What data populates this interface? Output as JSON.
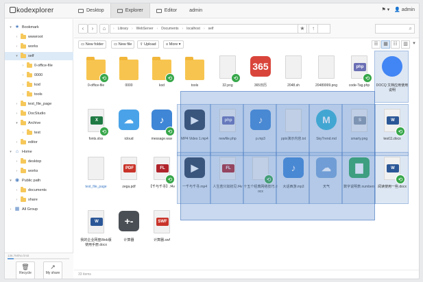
{
  "app": {
    "logo": "kodexplorer",
    "user": "admin"
  },
  "menu": [
    {
      "label": "Desktop",
      "icon": "desktop-icon",
      "active": false
    },
    {
      "label": "Explorer",
      "icon": "explorer-icon",
      "active": true
    },
    {
      "label": "Editor",
      "icon": "editor-icon",
      "active": false
    },
    {
      "label": "admin",
      "icon": "",
      "active": false
    }
  ],
  "sidebar": {
    "nodes": [
      {
        "label": "Bookmark",
        "icon": "star-icon",
        "expanded": true,
        "selected": false
      },
      {
        "label": "wwwroot",
        "icon": "folder-icon",
        "expanded": false,
        "selected": false
      },
      {
        "label": "works",
        "icon": "folder-icon",
        "expanded": false,
        "selected": false
      },
      {
        "label": "self",
        "icon": "folder-icon",
        "expanded": true,
        "selected": true
      },
      {
        "label": "0-office-file",
        "icon": "folder-icon",
        "expanded": false,
        "selected": false
      },
      {
        "label": "0000",
        "icon": "folder-icon",
        "expanded": false,
        "selected": false
      },
      {
        "label": "kod",
        "icon": "folder-icon",
        "expanded": false,
        "selected": false
      },
      {
        "label": "tools",
        "icon": "folder-icon",
        "expanded": false,
        "selected": false
      },
      {
        "label": "test_file_page",
        "icon": "folder-icon",
        "expanded": false,
        "selected": false
      },
      {
        "label": "DocStudio",
        "icon": "folder-icon",
        "expanded": false,
        "selected": false
      },
      {
        "label": "Archive",
        "icon": "folder-icon",
        "expanded": true,
        "selected": false
      },
      {
        "label": "test",
        "icon": "folder-icon",
        "expanded": false,
        "selected": false
      },
      {
        "label": "editor",
        "icon": "folder-icon",
        "expanded": false,
        "selected": false
      },
      {
        "label": "Home",
        "icon": "home-icon",
        "expanded": true,
        "selected": false
      },
      {
        "label": "desktop",
        "icon": "folder-icon",
        "expanded": false,
        "selected": false
      },
      {
        "label": "works",
        "icon": "folder-icon",
        "expanded": false,
        "selected": false
      },
      {
        "label": "Public path",
        "icon": "public-icon",
        "expanded": true,
        "selected": false
      },
      {
        "label": "documents",
        "icon": "folder-icon",
        "expanded": false,
        "selected": false
      },
      {
        "label": "share",
        "icon": "folder-icon",
        "expanded": false,
        "selected": false
      },
      {
        "label": "All Group",
        "icon": "group-icon",
        "expanded": false,
        "selected": false
      }
    ],
    "storage_text": "136.7M/No limit",
    "storage_used": 0.1,
    "recycle_label": "Recycle",
    "myshare_label": "My share"
  },
  "address": {
    "crumbs": [
      "Library",
      "WebServer",
      "Documents",
      "localhost",
      "self"
    ]
  },
  "toolbar": {
    "new_folder": "New folder",
    "new_file": "New file",
    "upload": "Upload",
    "more": "More"
  },
  "files": [
    {
      "name": "0-office-file",
      "type": "folder",
      "shared": true,
      "selected": false
    },
    {
      "name": "0000",
      "type": "folder",
      "shared": false,
      "selected": false
    },
    {
      "name": "kod",
      "type": "folder",
      "shared": true,
      "selected": false
    },
    {
      "name": "tools",
      "type": "folder",
      "shared": false,
      "selected": false
    },
    {
      "name": "32.png",
      "type": "image",
      "badge": "",
      "color": "#5a8fd0",
      "shared": true,
      "selected": false
    },
    {
      "name": "365日历",
      "type": "calendar",
      "badge": "365",
      "color": "#d9453b",
      "shared": false,
      "selected": false
    },
    {
      "name": "2048.sh",
      "type": "doc",
      "badge": "",
      "color": "#9a9a9a",
      "shared": false,
      "selected": false
    },
    {
      "name": "20489999.png",
      "type": "doc",
      "badge": "",
      "color": "#b7b7b7",
      "shared": false,
      "selected": false
    },
    {
      "name": "code-Tag.php",
      "type": "doc",
      "badge": "php",
      "color": "#6b6fb4",
      "shared": true,
      "selected": false
    },
    {
      "name": "DOCQ 文档应用使用说明",
      "type": "chrome",
      "badge": "",
      "color": "#4285f4",
      "shared": false,
      "selected": true
    },
    {
      "name": "fonts.xlsx",
      "type": "doc",
      "badge": "X",
      "color": "#1f7a43",
      "shared": true,
      "selected": false
    },
    {
      "name": "icloud",
      "type": "cloud",
      "badge": "☁",
      "color": "#4aa3e8",
      "shared": false,
      "selected": false
    },
    {
      "name": "message.wav",
      "type": "music",
      "badge": "♪",
      "color": "#3f86d6",
      "shared": true,
      "selected": false
    },
    {
      "name": "MP4 Video 1.mp4",
      "type": "video",
      "badge": "▶",
      "color": "#2a3c55",
      "shared": false,
      "selected": true
    },
    {
      "name": "newfile.php",
      "type": "doc",
      "badge": "php",
      "color": "#6b6fb4",
      "shared": false,
      "selected": true
    },
    {
      "name": "p.mp3",
      "type": "music",
      "badge": "♪",
      "color": "#3f86d6",
      "shared": false,
      "selected": true
    },
    {
      "name": "pptx演示内容.txt",
      "type": "doc",
      "badge": "",
      "color": "#9aa6b4",
      "shared": false,
      "selected": true
    },
    {
      "name": "SkyTrend.md",
      "type": "circle",
      "badge": "M",
      "color": "#35b3d4",
      "shared": false,
      "selected": true
    },
    {
      "name": "smarty.png",
      "type": "doc",
      "badge": "S",
      "color": "#8d99a6",
      "shared": false,
      "selected": true
    },
    {
      "name": "test11.docx",
      "type": "doc",
      "badge": "W",
      "color": "#2b5797",
      "shared": true,
      "selected": true
    },
    {
      "name": "test_file_page",
      "type": "blank",
      "badge": "",
      "color": "#cfcfcf",
      "shared": false,
      "selected": false
    },
    {
      "name": "zega.pdf",
      "type": "doc",
      "badge": "PDF",
      "color": "#c9342a",
      "shared": false,
      "selected": false
    },
    {
      "name": "【千与千寻】.f4v",
      "type": "doc",
      "badge": "FL",
      "color": "#b0232a",
      "shared": true,
      "selected": false
    },
    {
      "name": "一千与千寻.mp4",
      "type": "video",
      "badge": "▶",
      "color": "#2a3c55",
      "shared": false,
      "selected": true
    },
    {
      "name": "人生若只如初见.f4v",
      "type": "doc",
      "badge": "FL",
      "color": "#b0232a",
      "shared": false,
      "selected": true
    },
    {
      "name": "十五个经典网络技巧.docx",
      "type": "doc",
      "badge": "",
      "color": "#cfcfcf",
      "shared": true,
      "selected": true
    },
    {
      "name": "大话西游.mp3",
      "type": "music",
      "badge": "♪",
      "color": "#3f86d6",
      "shared": false,
      "selected": true
    },
    {
      "name": "天气",
      "type": "weather",
      "badge": "☁",
      "color": "#7aa6d8",
      "shared": false,
      "selected": true
    },
    {
      "name": "数字说明表.numbers",
      "type": "chart",
      "badge": "▇",
      "color": "#2ea85a",
      "shared": false,
      "selected": true
    },
    {
      "name": "阅读使用一些.docx",
      "type": "doc",
      "badge": "W",
      "color": "#2b5797",
      "shared": true,
      "selected": true
    },
    {
      "name": "我的企业网盘Web版使用手册.docx",
      "type": "doc",
      "badge": "W",
      "color": "#2b5797",
      "shared": false,
      "selected": false
    },
    {
      "name": "计算器",
      "type": "calc",
      "badge": "+-",
      "color": "#4a4f55",
      "shared": false,
      "selected": false
    },
    {
      "name": "计算器.swf",
      "type": "doc",
      "badge": "SWF",
      "color": "#c9342a",
      "shared": false,
      "selected": false
    }
  ],
  "status": {
    "text": "33 items"
  }
}
